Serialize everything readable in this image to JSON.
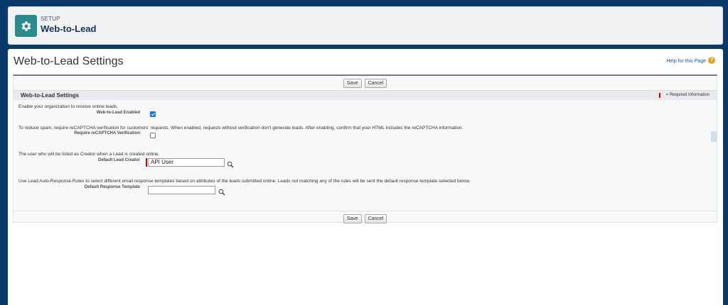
{
  "header": {
    "breadcrumb": "SETUP",
    "title": "Web-to-Lead"
  },
  "page": {
    "title": "Web-to-Lead Settings",
    "help_link": "Help for this Page"
  },
  "buttons": {
    "save": "Save",
    "cancel": "Cancel"
  },
  "section": {
    "title": "Web-to-Lead Settings",
    "required_info": "= Required Information"
  },
  "fields": {
    "enabled": {
      "description": "Enable your organization to receive online leads.",
      "label": "Web-to-Lead Enabled",
      "checked": true
    },
    "recaptcha": {
      "description": "To reduce spam, require reCAPTCHA verification for customers' requests. When enabled, requests without verification don't generate leads. After enabling, confirm that your HTML includes the reCAPTCHA information.",
      "label": "Require reCAPTCHA Verification",
      "checked": false
    },
    "creator": {
      "description": "The user who will be listed as Creator when a Lead is created online.",
      "label": "Default Lead Creator",
      "value": "API User"
    },
    "template": {
      "description": "Use Lead Auto-Response Rules to select different email response templates based on attributes of the leads submitted online. Leads not matching any of the rules will be sent the default response template selected below.",
      "label": "Default Response Template",
      "value": ""
    }
  },
  "colors": {
    "frame": "#0a3a6b",
    "accent": "#2a8a8c",
    "required": "#cc0000",
    "checkbox": "#1a73e8"
  },
  "icons": [
    "gear-icon",
    "help-icon",
    "lookup-icon"
  ]
}
